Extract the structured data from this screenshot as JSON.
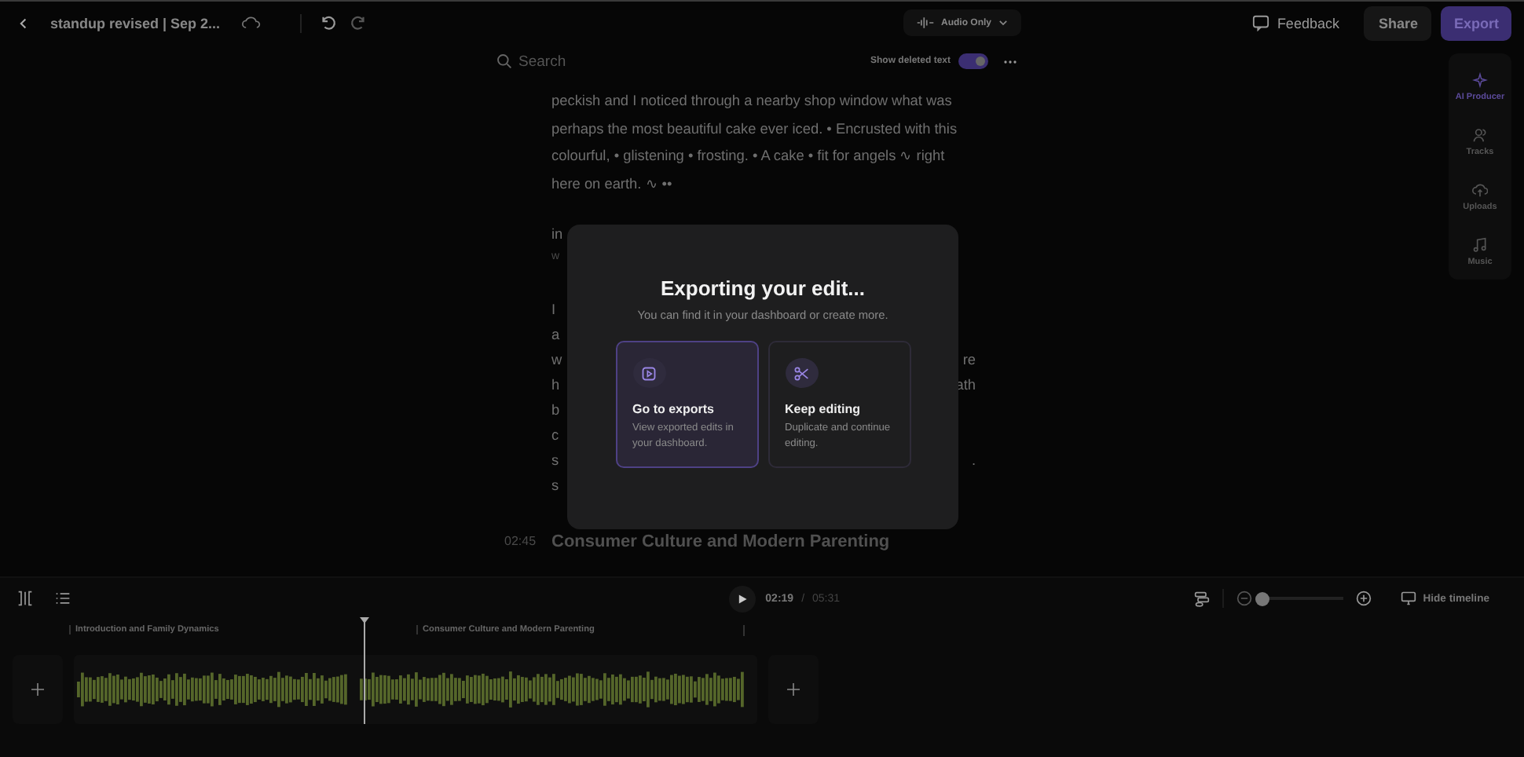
{
  "header": {
    "title": "standup revised | Sep 2...",
    "mode": "Audio Only",
    "feedback": "Feedback",
    "share": "Share",
    "export": "Export"
  },
  "editor": {
    "search_placeholder": "Search",
    "show_deleted": {
      "label": "Show deleted text",
      "on": true
    },
    "lines": [
      "peckish and I noticed through a nearby shop window what was",
      "perhaps the most beautiful cake ever iced. • Encrusted with this",
      "colourful, • glistening • frosting. • A cake • fit for angels ∿ right",
      "here on earth. ∿ ••"
    ],
    "covered_lines": [
      {
        "left": "in",
        "faint": false
      },
      {
        "left": "w",
        "faint": true
      },
      {
        "left": "I",
        "faint": false
      },
      {
        "left": "a",
        "faint": false
      },
      {
        "left": "w",
        "right": "re",
        "faint": false
      },
      {
        "left": "h",
        "right": "ath",
        "faint": false
      },
      {
        "left": "b",
        "faint": false
      },
      {
        "left": "c",
        "faint": false
      },
      {
        "left": "s",
        "right": ".",
        "faint": false
      },
      {
        "left": "s",
        "faint": false
      }
    ],
    "chapter": {
      "time": "02:45",
      "title": "Consumer Culture and Modern Parenting"
    }
  },
  "sidebar": [
    {
      "label": "AI Producer",
      "kind": "sparkle",
      "selected": true
    },
    {
      "label": "Tracks",
      "kind": "people",
      "selected": false
    },
    {
      "label": "Uploads",
      "kind": "upload",
      "selected": false
    },
    {
      "label": "Music",
      "kind": "music",
      "selected": false
    }
  ],
  "timeline": {
    "current": "02:19",
    "separator": "/",
    "total": "05:31",
    "zoom": {
      "level": 0.05
    },
    "hide_label": "Hide timeline",
    "chapters": [
      "Introduction and Family Dynamics",
      "Consumer Culture and Modern Parenting"
    ]
  },
  "modal": {
    "title": "Exporting your edit...",
    "subtitle": "You can find it in your dashboard or create more.",
    "options": [
      {
        "kind": "exports",
        "title": "Go to exports",
        "description": "View exported edits in your dashboard.",
        "selected": true
      },
      {
        "kind": "edit",
        "title": "Keep editing",
        "description": "Duplicate and continue editing.",
        "selected": false
      }
    ]
  }
}
